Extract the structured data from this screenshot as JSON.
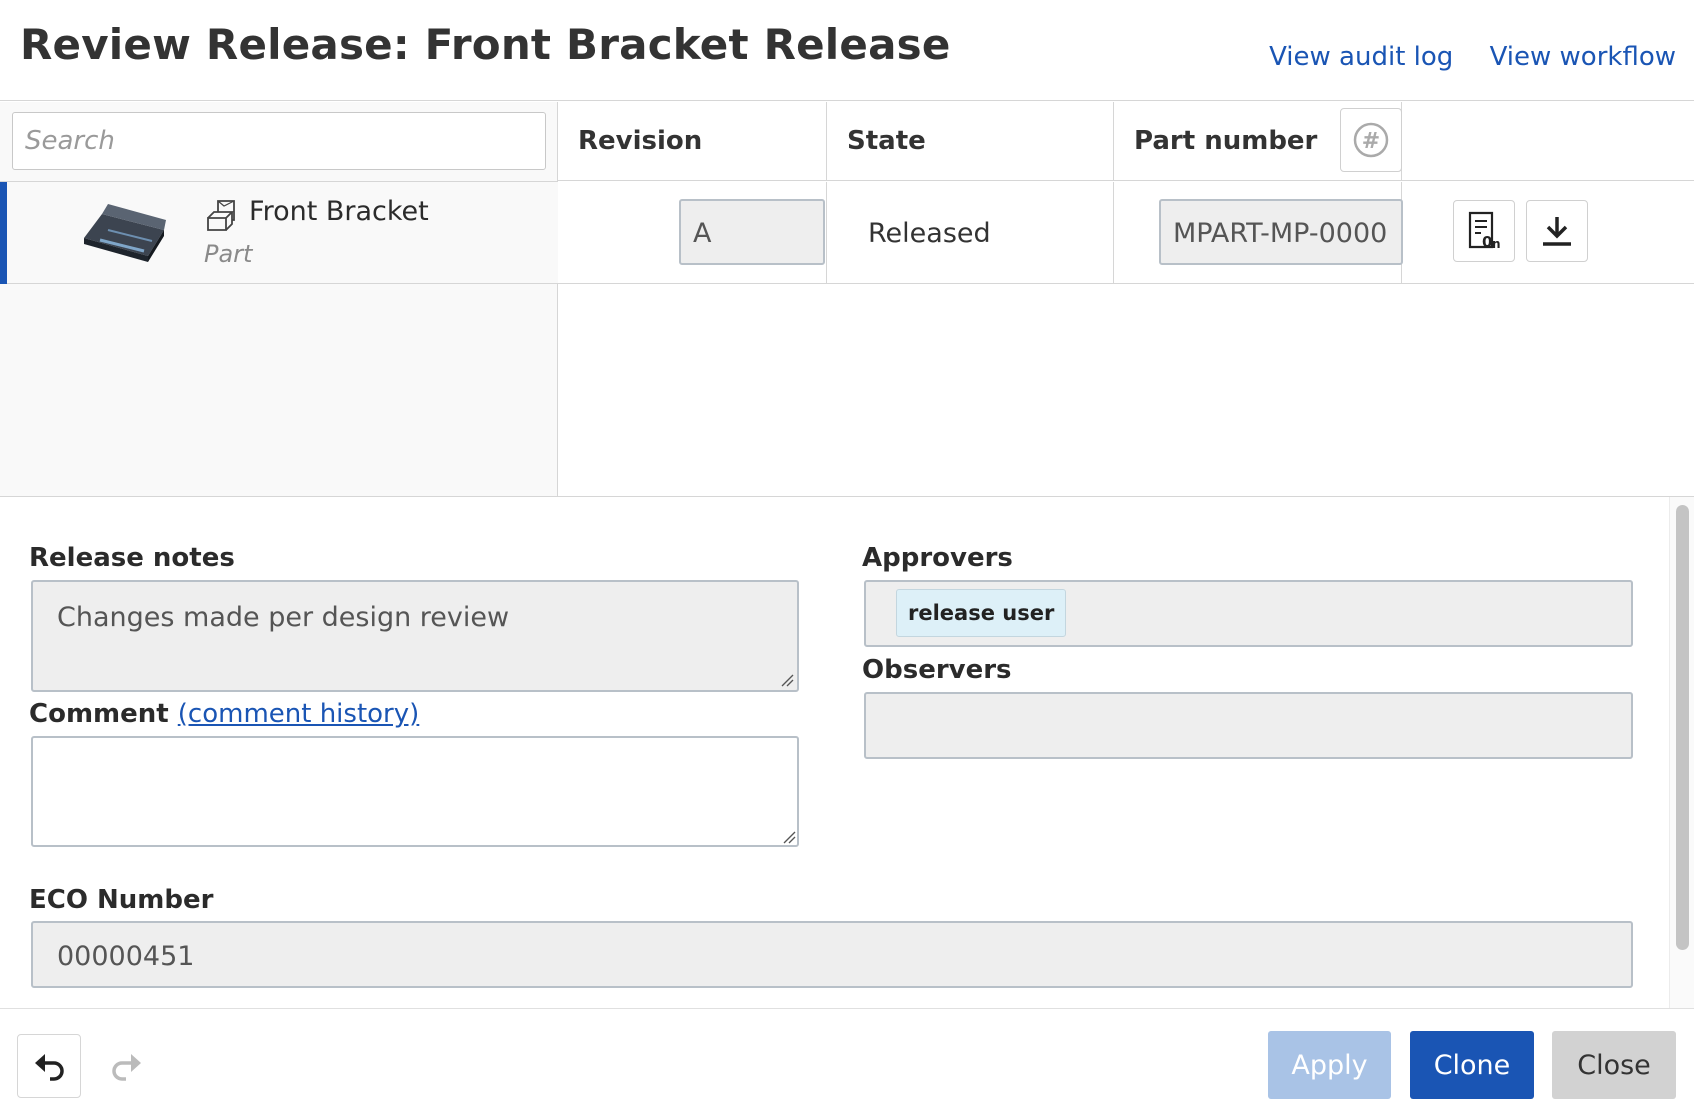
{
  "header": {
    "title": "Review Release: Front Bracket Release",
    "links": {
      "audit_log": "View audit log",
      "workflow": "View workflow"
    }
  },
  "grid": {
    "search_placeholder": "Search",
    "columns": {
      "revision": "Revision",
      "state": "State",
      "part_number": "Part number"
    },
    "rows": [
      {
        "name": "Front Bracket",
        "type": "Part",
        "revision": "A",
        "state": "Released",
        "part_number": "MPART-MP-0000"
      }
    ]
  },
  "form": {
    "release_notes": {
      "label": "Release notes",
      "value": "Changes made per design review"
    },
    "comment": {
      "label": "Comment",
      "history_link": "(comment history)",
      "value": ""
    },
    "approvers": {
      "label": "Approvers",
      "chips": [
        "release user"
      ]
    },
    "observers": {
      "label": "Observers"
    },
    "eco_number": {
      "label": "ECO Number",
      "value": "00000451"
    }
  },
  "footer": {
    "apply": "Apply",
    "clone": "Clone",
    "close": "Close"
  },
  "colors": {
    "accent": "#1a55b4",
    "apply_disabled": "#a9c3e6",
    "chip_bg": "#ddf0f8"
  },
  "icons": [
    "part-thumbnail",
    "part-icon",
    "part-number-generate-icon",
    "document-properties-icon",
    "download-icon",
    "undo-icon",
    "redo-icon"
  ]
}
